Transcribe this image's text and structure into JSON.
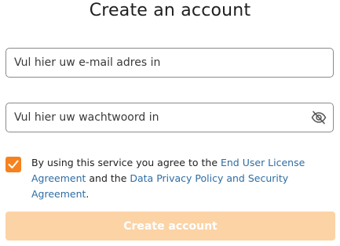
{
  "page": {
    "title": "Create an account"
  },
  "form": {
    "email": {
      "value": "",
      "placeholder": "Vul hier uw e-mail adres in"
    },
    "password": {
      "value": "",
      "placeholder": "Vul hier uw wachtwoord in",
      "toggle_icon": "eye-slash-icon"
    },
    "consent": {
      "checked": true,
      "checkbox_color": "#f5821f",
      "text_before": "By using this service you agree to the ",
      "eula_link": "End User License Agreement",
      "text_middle": " and the ",
      "privacy_link": "Data Privacy Policy and Security Agreement",
      "text_after": ".",
      "link_color": "#2e6da4"
    },
    "submit": {
      "label": "Create account",
      "background": "#fcd3a5",
      "text_color": "#ffffff"
    }
  }
}
